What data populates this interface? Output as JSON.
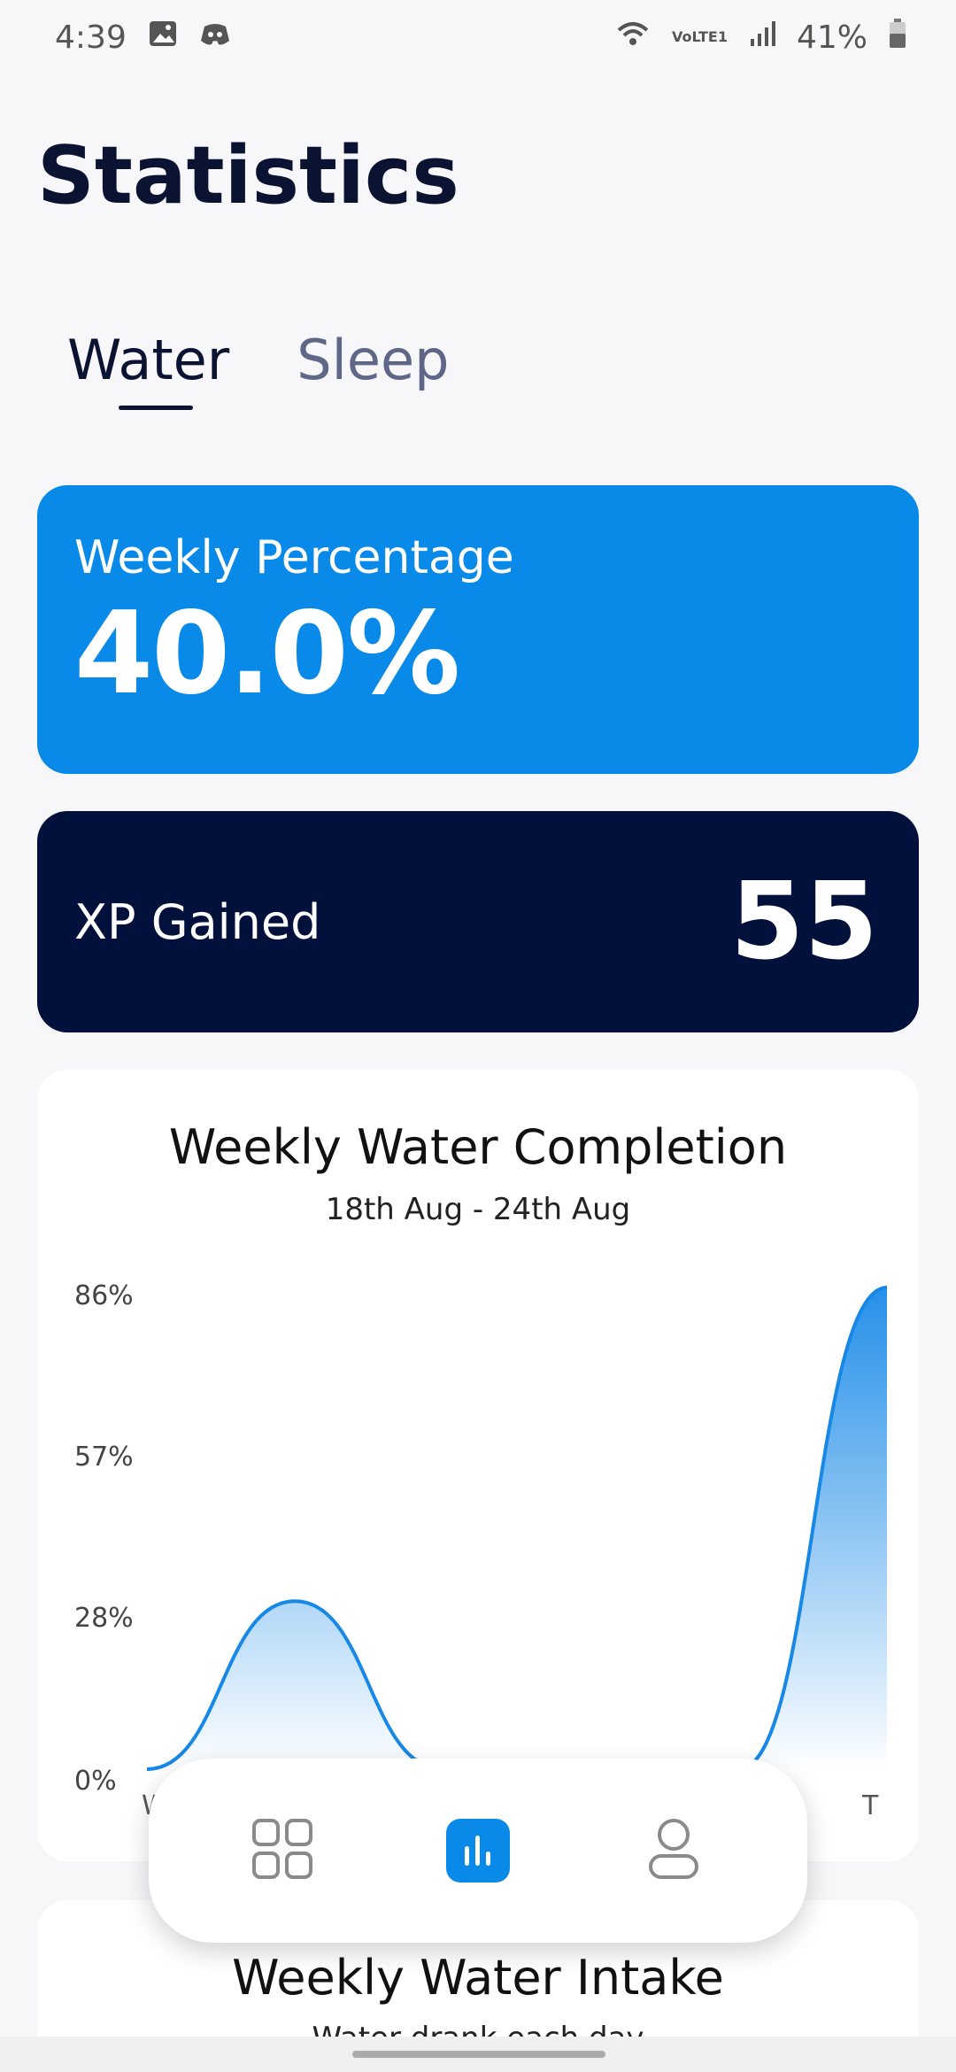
{
  "status_bar": {
    "time": "4:39",
    "battery": "41%",
    "network": "VoLTE1",
    "icons": [
      "gallery-icon",
      "discord-icon",
      "wifi-icon",
      "signal-icon",
      "battery-icon"
    ]
  },
  "header": {
    "title": "Statistics"
  },
  "tabs": [
    {
      "label": "Water",
      "active": true
    },
    {
      "label": "Sleep",
      "active": false
    }
  ],
  "weekly_percentage": {
    "label": "Weekly Percentage",
    "value": "40.0%"
  },
  "xp": {
    "label": "XP Gained",
    "value": "55"
  },
  "completion_chart": {
    "title": "Weekly Water Completion",
    "subtitle": "18th Aug - 24th Aug"
  },
  "chart_data": {
    "type": "area",
    "title": "Weekly Water Completion",
    "subtitle": "18th Aug - 24th Aug",
    "y_ticks": [
      "0%",
      "28%",
      "57%",
      "86%"
    ],
    "x_tick_labels": [
      "W",
      "T"
    ],
    "ylim": [
      0,
      86
    ],
    "x": [
      0,
      1,
      2,
      3,
      4,
      5
    ],
    "values": [
      0,
      30,
      0,
      0,
      0,
      86
    ],
    "grid": false,
    "colors": {
      "line": "#1888e6",
      "fill_top": "#1a8ae8",
      "fill_bottom": "#ffffff"
    }
  },
  "intake_chart": {
    "title": "Weekly Water Intake",
    "subtitle": "Water drank each day"
  },
  "bottom_nav": {
    "items": [
      "dashboard-icon",
      "stats-icon",
      "profile-icon"
    ],
    "active": "stats-icon"
  },
  "colors": {
    "accent": "#0a8ae8",
    "dark": "#02113b",
    "background": "#f7f7fa"
  }
}
